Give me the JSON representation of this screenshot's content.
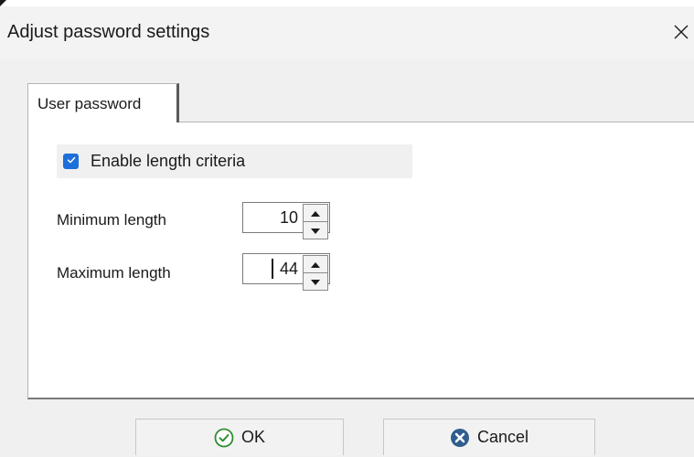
{
  "dialog": {
    "title": "Adjust password settings"
  },
  "tabs": [
    {
      "label": "User password",
      "selected": true
    }
  ],
  "length_criteria": {
    "enable_label": "Enable length criteria",
    "enabled": true,
    "minimum": {
      "label": "Minimum length",
      "value": "10"
    },
    "maximum": {
      "label": "Maximum length",
      "value": "44"
    }
  },
  "buttons": {
    "ok_label": "OK",
    "cancel_label": "Cancel"
  },
  "icons": {
    "close": "close-icon",
    "check": "check-icon",
    "spin_up": "arrow-up-icon",
    "spin_down": "arrow-down-icon",
    "ok": "check-circle-icon",
    "cancel": "cancel-circle-icon"
  },
  "colors": {
    "accent": "#1e6fd9",
    "ok_icon": "#2e8b2e",
    "cancel_icon": "#2f5d8c"
  }
}
